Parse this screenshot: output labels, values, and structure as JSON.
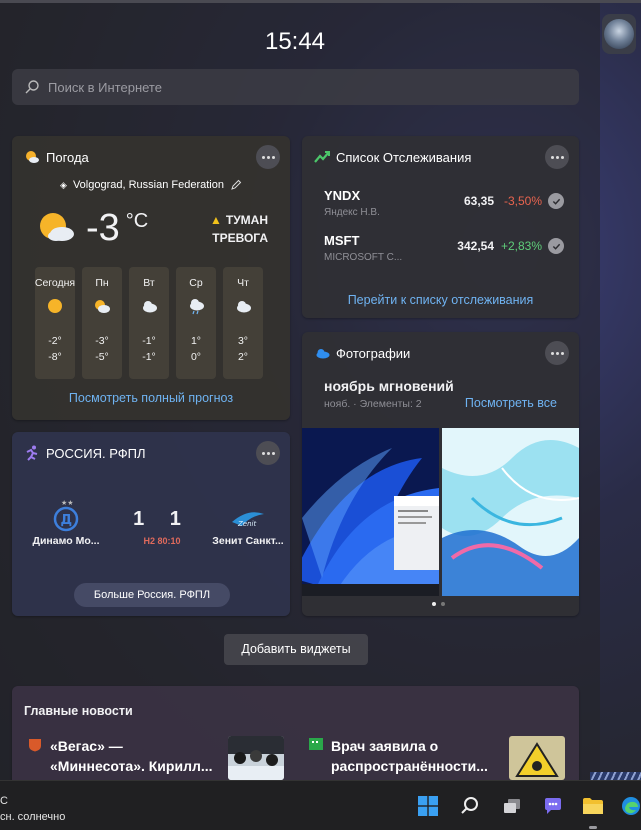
{
  "clock": "15:44",
  "search": {
    "placeholder": "Поиск в Интернете"
  },
  "weather": {
    "title": "Погода",
    "location": "Volgograd, Russian Federation",
    "temp": "-3",
    "unit": "°C",
    "alert_line1": "ТУМАН",
    "alert_line2": "ТРЕВОГА",
    "days": [
      {
        "name": "Сегодня",
        "icon": "sun-icon",
        "hi": "-2°",
        "lo": "-8°"
      },
      {
        "name": "Пн",
        "icon": "partly-cloudy-icon",
        "hi": "-3°",
        "lo": "-5°"
      },
      {
        "name": "Вт",
        "icon": "cloud-icon",
        "hi": "-1°",
        "lo": "-1°"
      },
      {
        "name": "Ср",
        "icon": "rain-cloud-icon",
        "hi": "1°",
        "lo": "0°"
      },
      {
        "name": "Чт",
        "icon": "cloud-icon",
        "hi": "3°",
        "lo": "2°"
      }
    ],
    "link": "Посмотреть полный прогноз"
  },
  "watchlist": {
    "title": "Список Отслеживания",
    "stocks": [
      {
        "symbol": "YNDX",
        "name": "Яндекс Н.В.",
        "price": "63,35",
        "change": "-3,50%",
        "color": "#e8644f"
      },
      {
        "symbol": "MSFT",
        "name": "MICROSOFT C...",
        "price": "342,54",
        "change": "+2,83%",
        "color": "#5fce7a"
      }
    ],
    "link": "Перейти к списку отслеживания"
  },
  "sport": {
    "title": "РОССИЯ. РФПЛ",
    "home": "Динамо Мо...",
    "away": "Зенит Санкт...",
    "score": "1 1",
    "time": "H2 80:10",
    "more": "Больше Россия. РФПЛ"
  },
  "photos": {
    "title": "Фотографии",
    "album": "ноябрь мгновений",
    "meta": "нояб. · Элементы: 2",
    "link": "Посмотреть все"
  },
  "add_widgets": "Добавить виджеты",
  "news": {
    "title": "Главные новости",
    "items": [
      {
        "line1": "«Вегас» —",
        "line2": "«Миннесота». Кирилл..."
      },
      {
        "line1": "Врач заявила о",
        "line2": "распространённости..."
      }
    ]
  },
  "taskbar": {
    "weather_line1": "С",
    "weather_line2": "сн. солнечно"
  }
}
